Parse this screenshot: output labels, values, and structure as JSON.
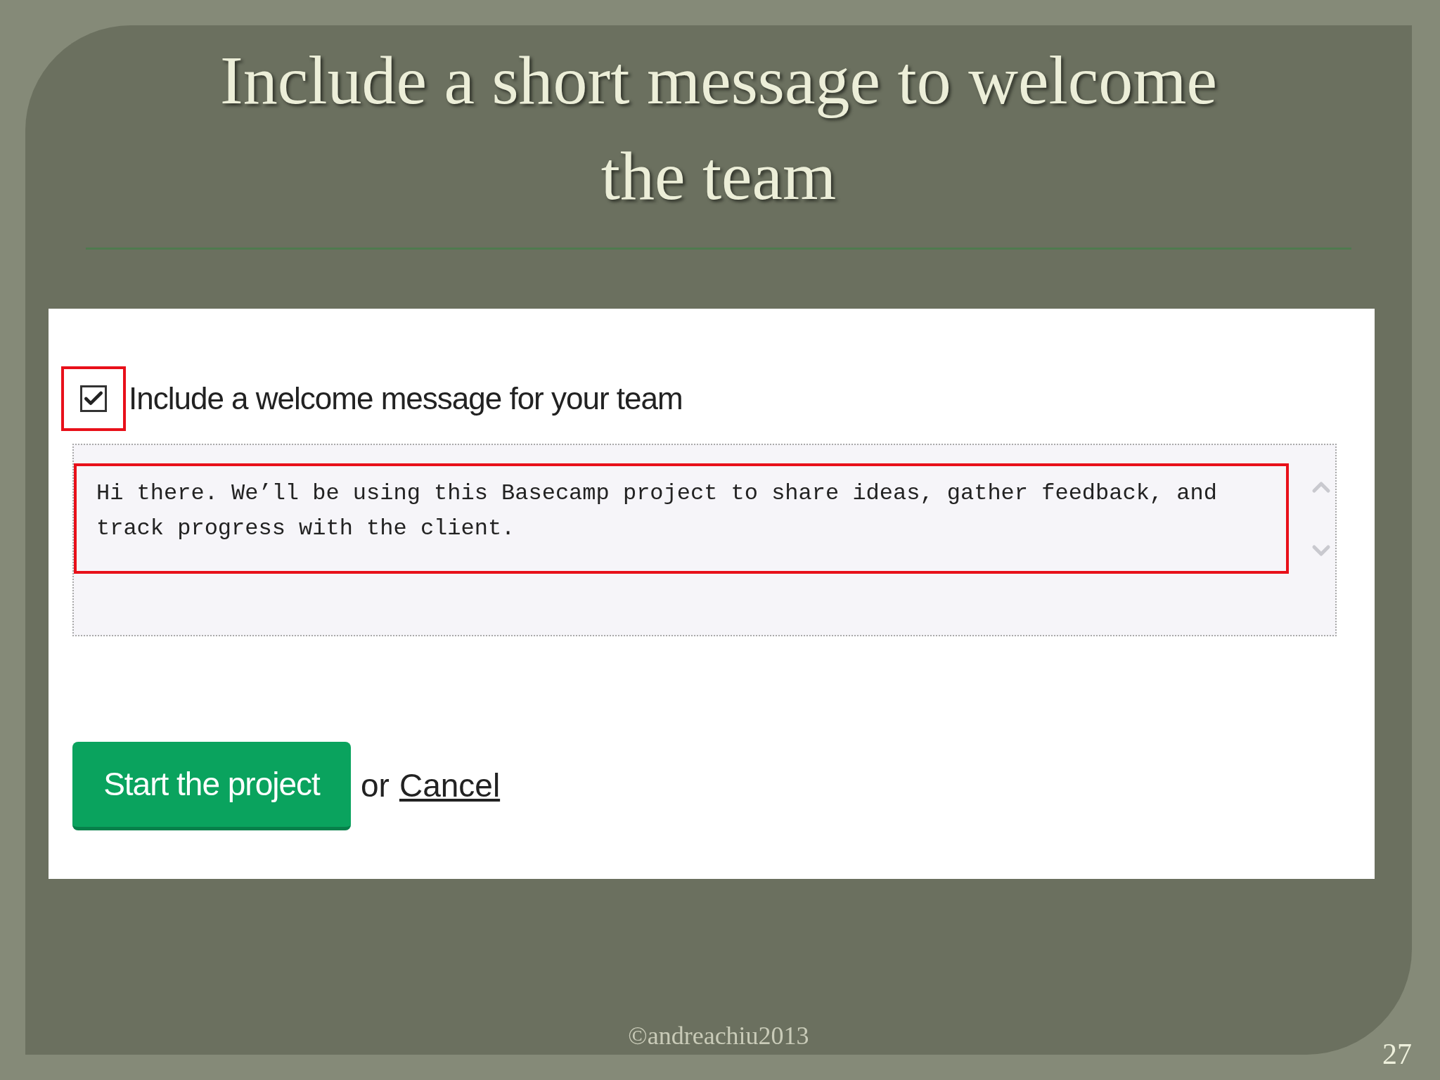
{
  "slide": {
    "title": "Include a short message to welcome the team",
    "footer": "©andreachiu2013",
    "page_number": "27"
  },
  "form": {
    "checkbox": {
      "label": "Include a welcome message for your team",
      "checked": true
    },
    "message": {
      "value": "Hi there. We’ll be using this Basecamp project to share ideas, gather feedback, and track progress with the client."
    },
    "start_button": "Start the project",
    "separator": "or",
    "cancel_link": "Cancel"
  }
}
